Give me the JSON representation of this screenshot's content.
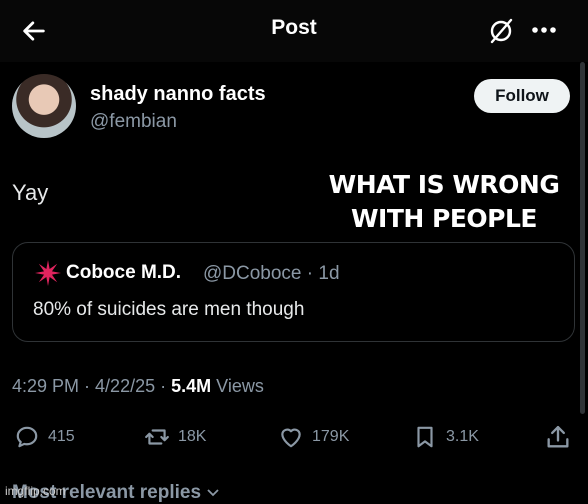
{
  "header": {
    "title": "Post"
  },
  "author": {
    "display_name": "shady nanno facts",
    "handle": "@fembian",
    "follow_label": "Follow"
  },
  "tweet": {
    "text": "Yay"
  },
  "meme_caption": "WHAT IS WRONG WITH PEOPLE",
  "quote": {
    "name": "Coboce M.D.",
    "handle": "@DCoboce",
    "age": "1d",
    "text": "80% of suicides are men though"
  },
  "meta": {
    "time": "4:29 PM",
    "date": "4/22/25",
    "views_count": "5.4M",
    "views_label": "Views"
  },
  "stats": {
    "replies": "415",
    "reposts": "18K",
    "likes": "179K",
    "bookmarks": "3.1K"
  },
  "footer": {
    "replies_label": "Most relevant replies"
  },
  "watermark": "imgflip.com",
  "colors": {
    "background": "#000000",
    "secondary_text": "#8b98a5",
    "border": "#2f3336",
    "quote_icon": "#e0245e"
  },
  "icons": [
    "back-arrow-icon",
    "grok-icon",
    "more-icon",
    "reply-icon",
    "repost-icon",
    "like-icon",
    "bookmark-icon",
    "share-icon",
    "chevron-down-icon"
  ]
}
